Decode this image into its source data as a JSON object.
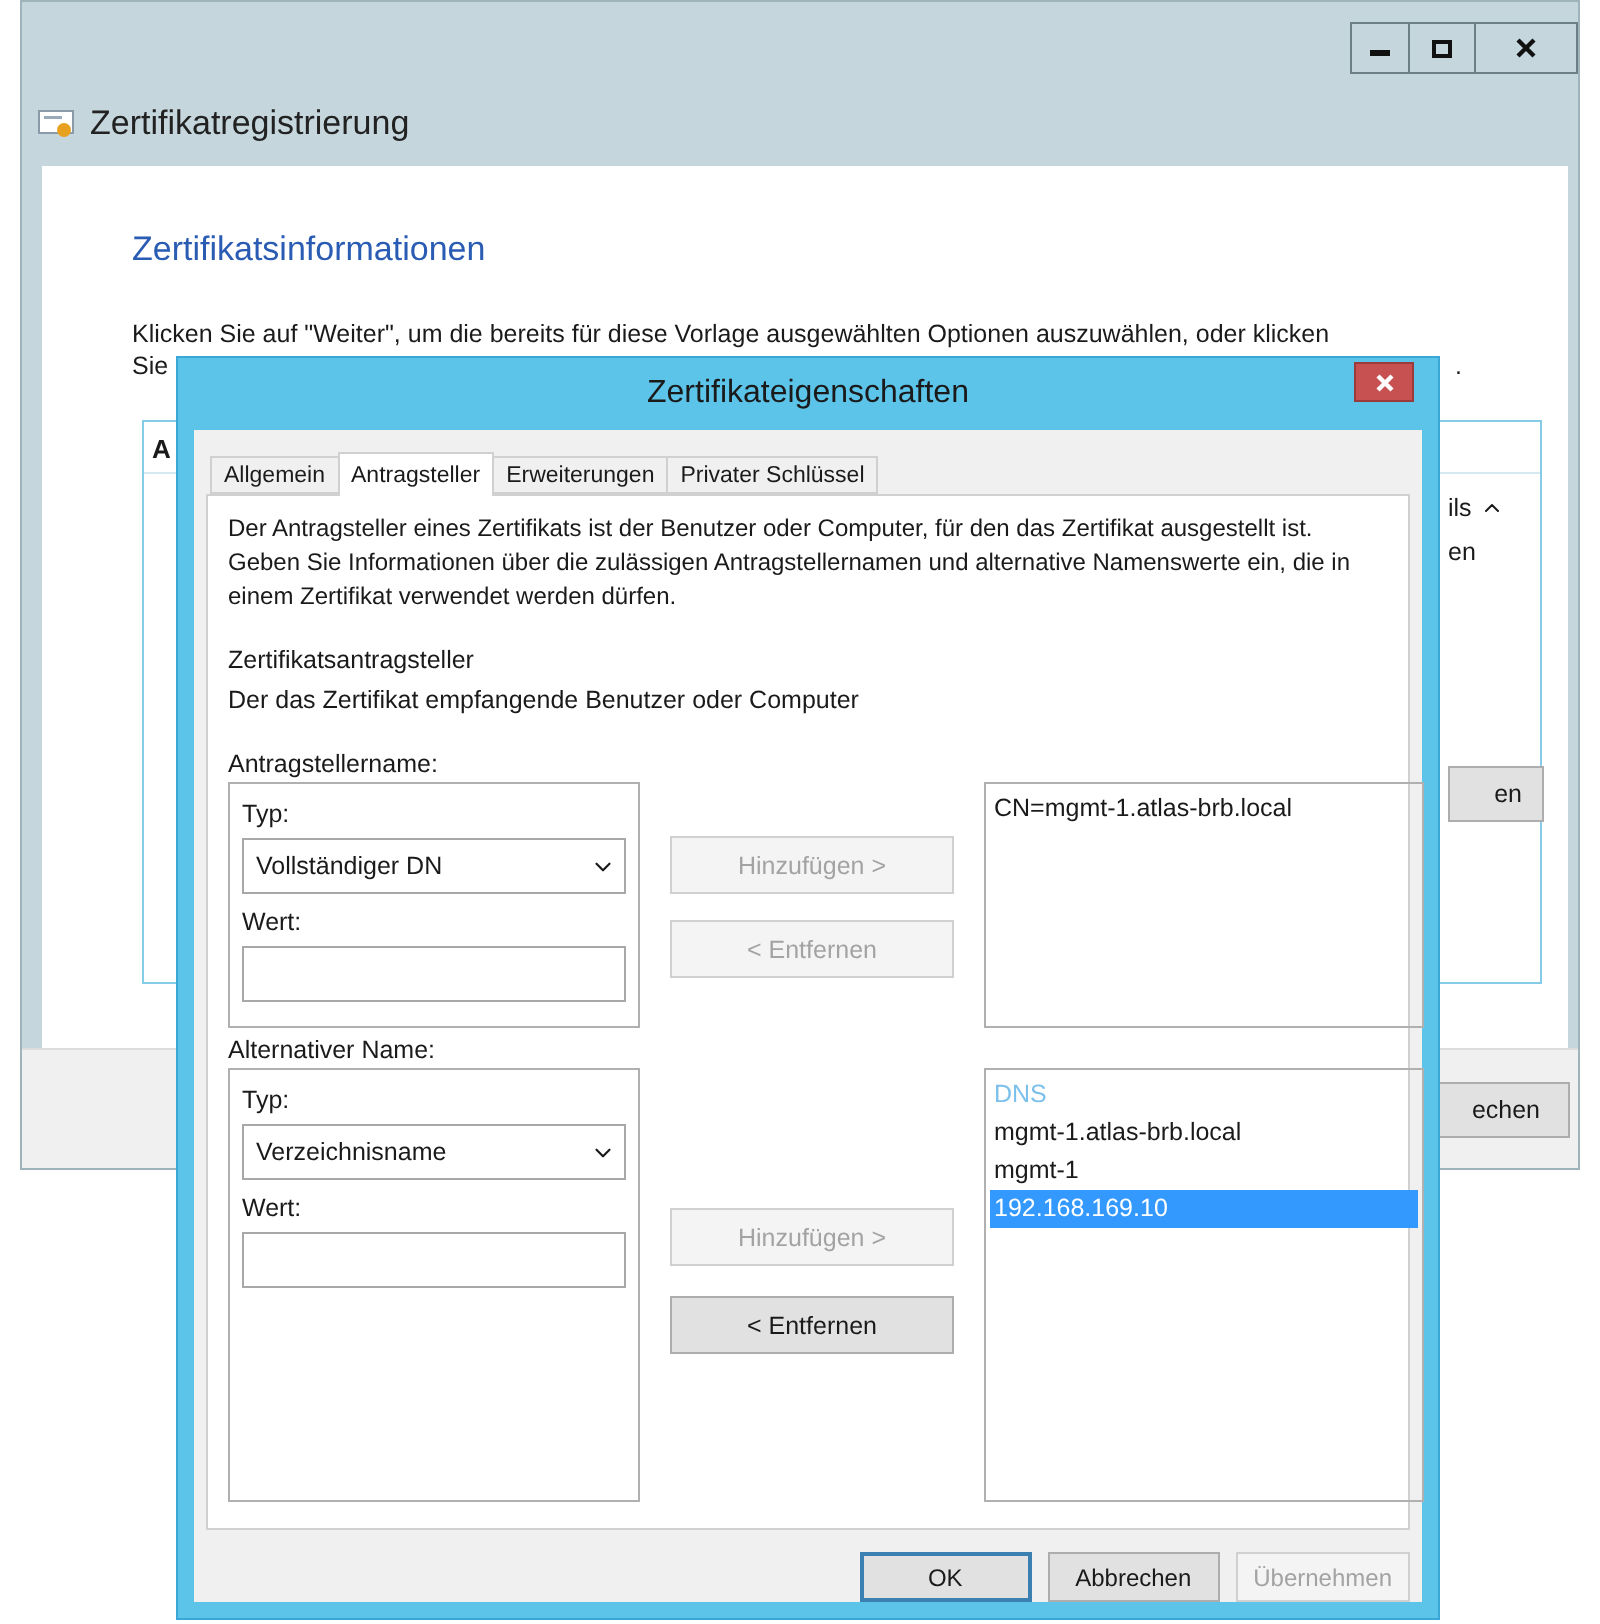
{
  "background_window": {
    "title": "Zertifikatregistrierung",
    "heading": "Zertifikatsinformationen",
    "instruction_line_1": "Klicken Sie auf \"Weiter\", um die bereits für diese Vorlage ausgewählten Optionen auszuwählen, oder klicken",
    "instruction_line_2_start": "Sie",
    "instruction_line_2_end": ".",
    "panel_header": "A",
    "panel_fragments": [
      "ils",
      "en"
    ],
    "panel_button": "en",
    "footer_button": "echen"
  },
  "dialog": {
    "title": "Zertifikateigenschaften",
    "tabs": [
      {
        "label": "Allgemein",
        "selected": false
      },
      {
        "label": "Antragsteller",
        "selected": true
      },
      {
        "label": "Erweiterungen",
        "selected": false
      },
      {
        "label": "Privater Schlüssel",
        "selected": false
      }
    ],
    "description": "Der Antragsteller eines Zertifikats ist der Benutzer oder Computer, für den das Zertifikat ausgestellt ist. Geben Sie Informationen über die zulässigen Antragstellernamen und alternative Namenswerte ein, die in einem Zertifikat verwendet werden dürfen.",
    "section_title": "Zertifikatsantragsteller",
    "section_hint": "Der das Zertifikat empfangende Benutzer oder Computer",
    "groups": [
      {
        "label": "Antragstellername:",
        "type_label": "Typ:",
        "type_value": "Vollständiger DN",
        "value_label": "Wert:",
        "add_button": {
          "label": "Hinzufügen >",
          "disabled": true
        },
        "remove_button": {
          "label": "< Entfernen",
          "disabled": true
        },
        "entries": [
          {
            "text": "CN=mgmt-1.atlas-brb.local",
            "kind": "item",
            "selected": false
          }
        ]
      },
      {
        "label": "Alternativer Name:",
        "type_label": "Typ:",
        "type_value": "Verzeichnisname",
        "value_label": "Wert:",
        "add_button": {
          "label": "Hinzufügen >",
          "disabled": true
        },
        "remove_button": {
          "label": "< Entfernen",
          "disabled": false
        },
        "entries": [
          {
            "text": "DNS",
            "kind": "header",
            "selected": false
          },
          {
            "text": "mgmt-1.atlas-brb.local",
            "kind": "item",
            "selected": false
          },
          {
            "text": "mgmt-1",
            "kind": "item",
            "selected": false
          },
          {
            "text": "192.168.169.10",
            "kind": "item",
            "selected": true
          }
        ]
      }
    ],
    "buttons": [
      {
        "label": "OK",
        "disabled": false,
        "default": true
      },
      {
        "label": "Abbrechen",
        "disabled": false,
        "default": false
      },
      {
        "label": "Übernehmen",
        "disabled": true,
        "default": false
      }
    ]
  }
}
